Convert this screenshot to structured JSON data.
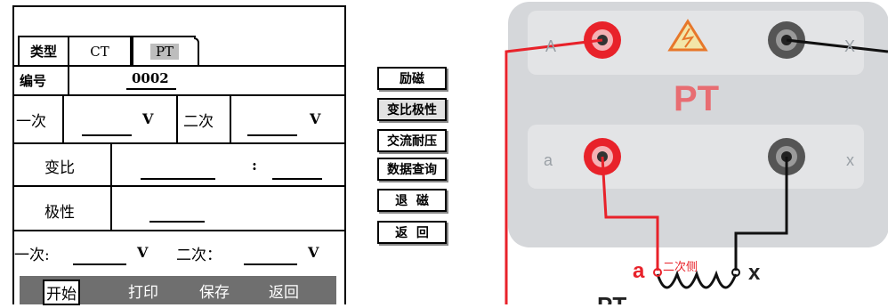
{
  "panel": {
    "tab_label": "类型",
    "tabs": [
      {
        "label": "CT"
      },
      {
        "label": "PT"
      }
    ],
    "number_label": "编号",
    "number_value": "0002",
    "primary_label": "一次",
    "primary_unit": "V",
    "secondary_label": "二次",
    "secondary_unit": "V",
    "ratio_label": "变比",
    "ratio_separator": ":",
    "polarity_label": "极性",
    "bottom_primary_label": "一次:",
    "bottom_primary_unit": "V",
    "bottom_secondary_label": "二次：",
    "bottom_secondary_unit": "V",
    "footer": {
      "start": "开始",
      "print": "打印",
      "save": "保存",
      "back": "返回"
    }
  },
  "side_menu": [
    {
      "label": "励磁"
    },
    {
      "label": "变比极性"
    },
    {
      "label": "交流耐压"
    },
    {
      "label": "数据查询"
    },
    {
      "label": "退  磁"
    },
    {
      "label": "返  回"
    }
  ],
  "photo": {
    "title": "PT",
    "terminal_A": "A",
    "terminal_X": "X",
    "terminal_a": "a",
    "terminal_x": "x",
    "coil_a": "a",
    "coil_x": "x",
    "secondary_side": "二次侧",
    "bottom_text": "PT",
    "colors": {
      "red": "#e8222a",
      "panel": "#d5d7da",
      "plate": "#e3e4e6",
      "title": "#e86d72"
    }
  }
}
